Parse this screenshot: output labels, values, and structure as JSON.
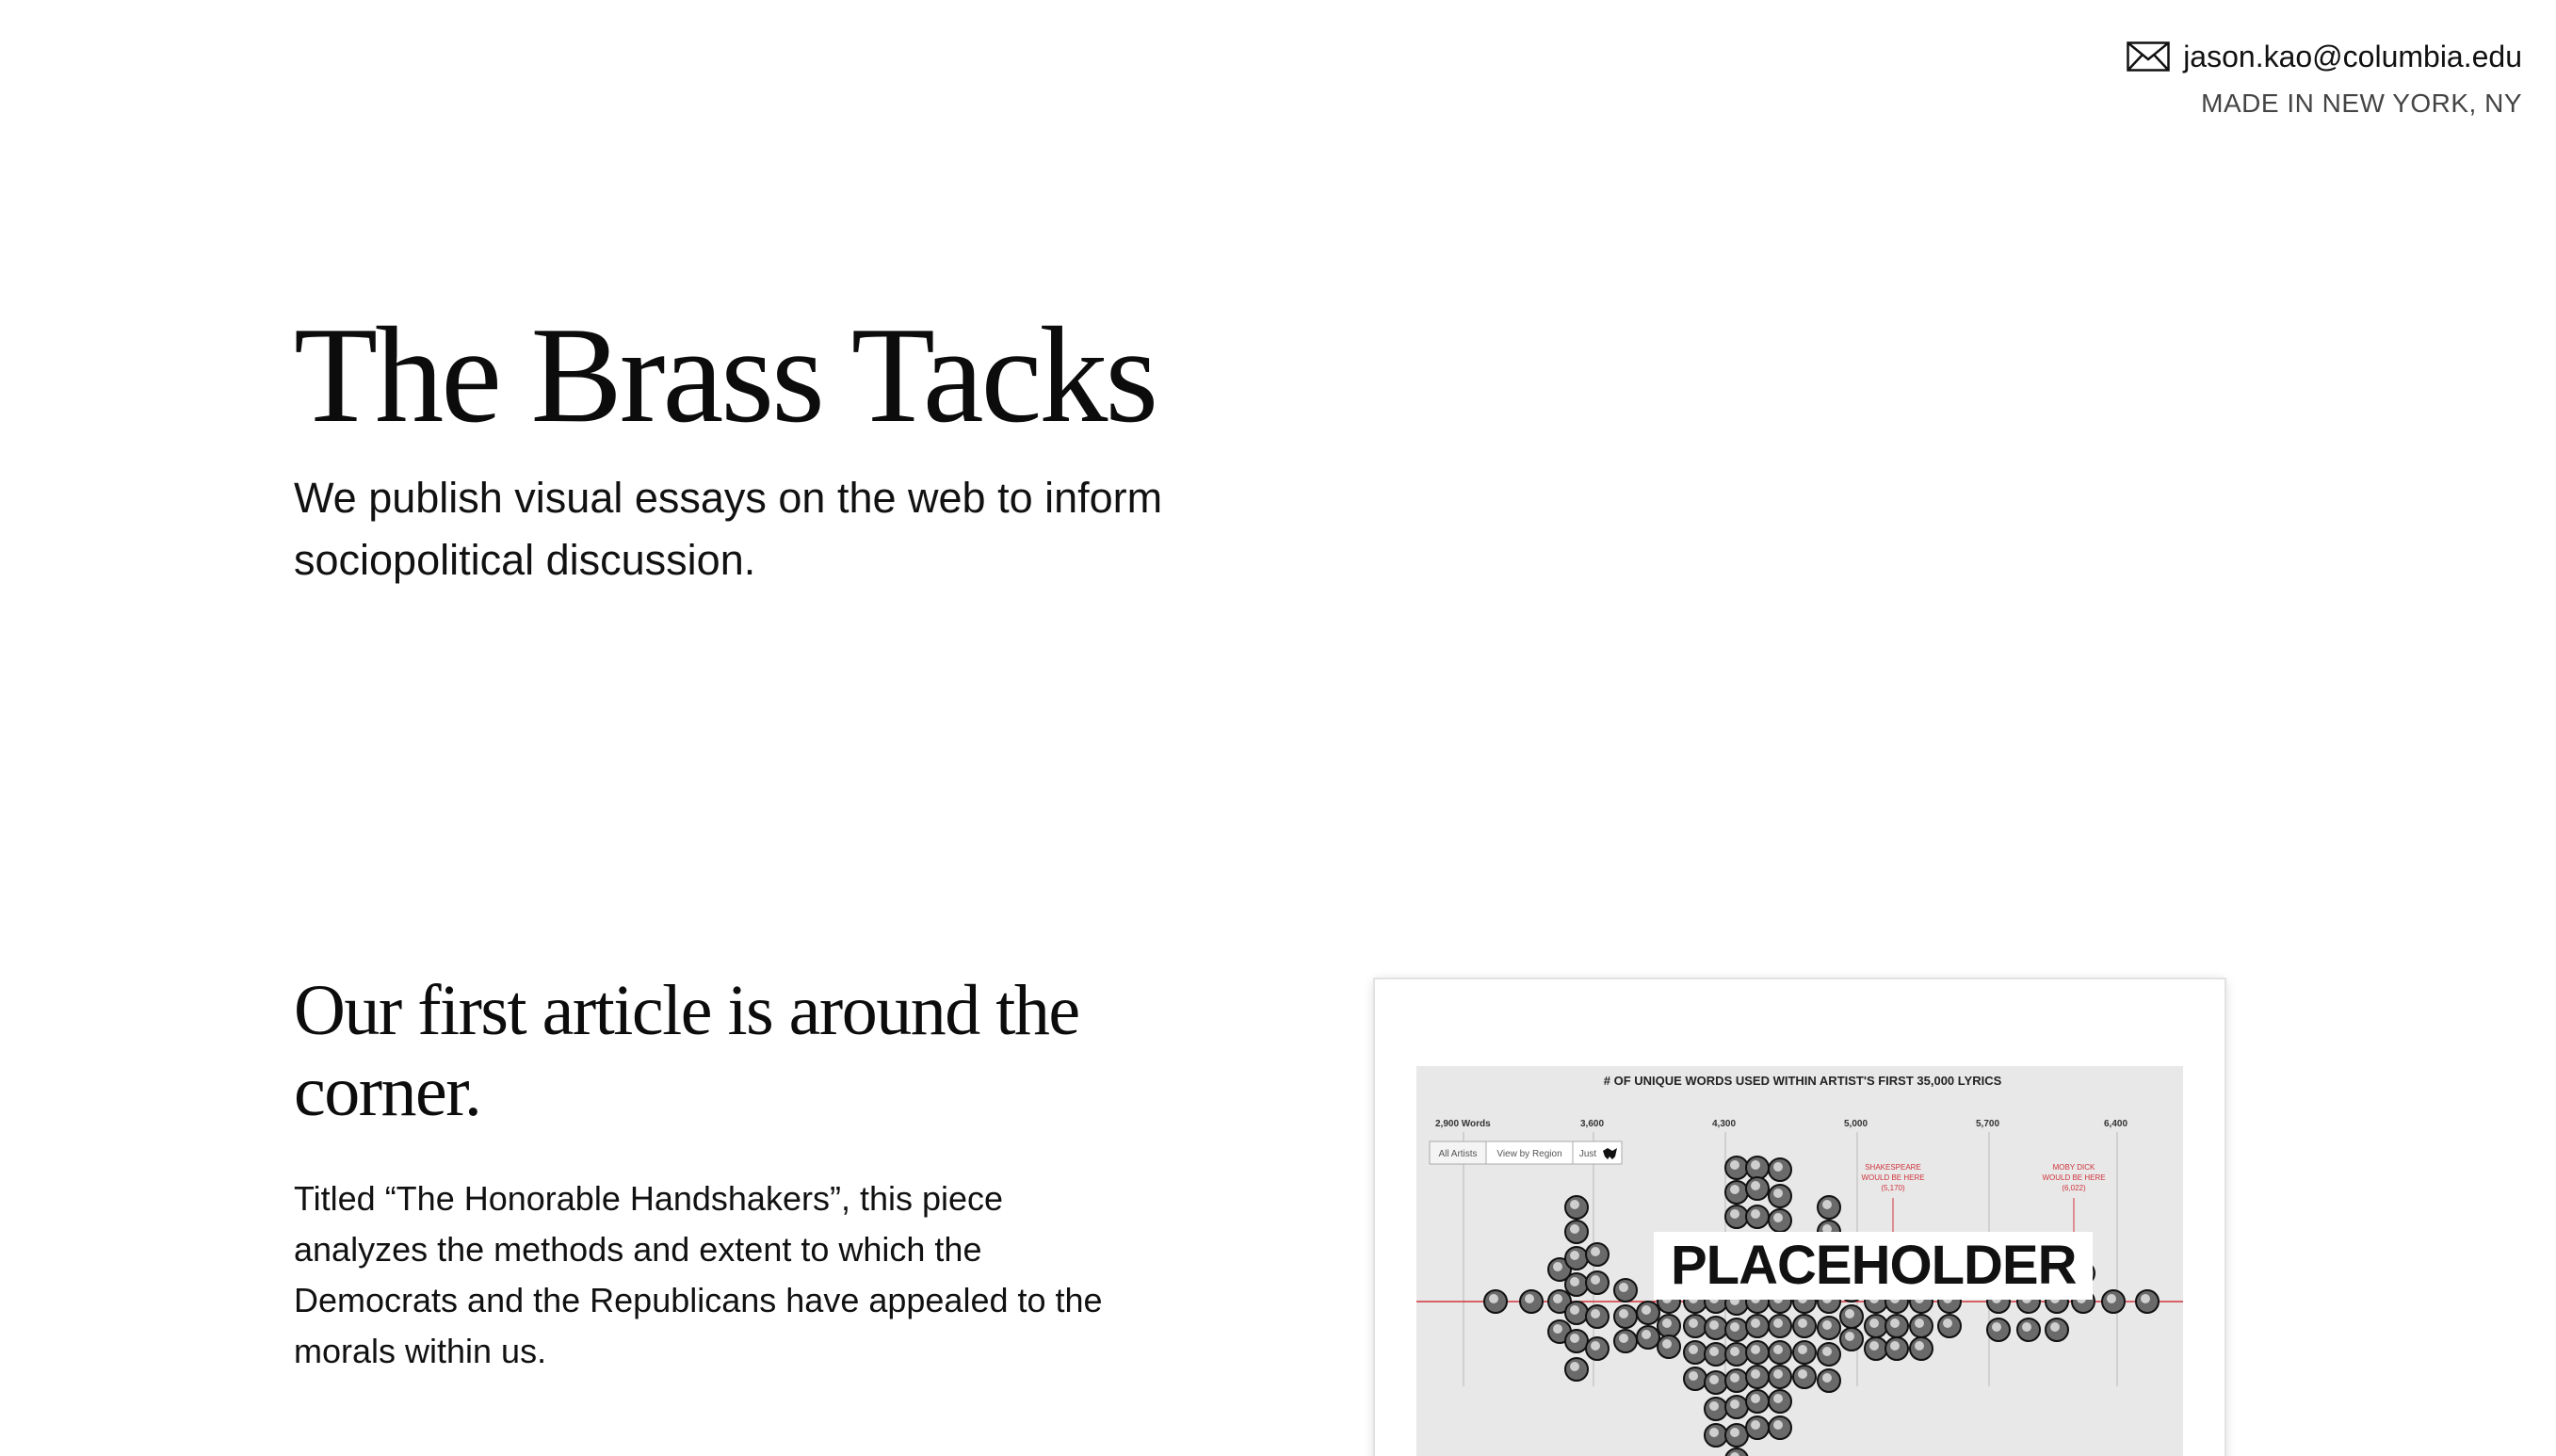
{
  "contact": {
    "email": "jason.kao@columbia.edu",
    "location": "MADE IN NEW YORK, NY"
  },
  "hero": {
    "title": "The Brass Tacks",
    "tagline": "We publish visual essays on the web to inform sociopolitical discussion."
  },
  "teaser": {
    "heading": "Our first article is around the corner.",
    "body": "Titled “The Honorable Handshakers”, this piece analyzes the methods and extent to which the Democrats and the Republicans have appealed to the morals within us."
  },
  "preview": {
    "placeholder": "PLACEHOLDER",
    "chart_title": "# OF UNIQUE WORDS USED WITHIN ARTIST'S FIRST 35,000 LYRICS",
    "axis_ticks": [
      "2,900 Words",
      "3,600",
      "4,300",
      "5,000",
      "5,700",
      "6,400"
    ],
    "filters": [
      "All Artists",
      "View by Region",
      "Just"
    ],
    "annotations": [
      {
        "lines": [
          "SHAKESPEARE",
          "WOULD BE HERE",
          "(5,170)"
        ]
      },
      {
        "lines": [
          "MOBY DICK",
          "WOULD BE HERE",
          "(6,022)"
        ]
      }
    ],
    "colors": {
      "accent": "#d0343c",
      "background": "#e8e8e8"
    }
  },
  "icons": {
    "mail": "mail-icon"
  }
}
